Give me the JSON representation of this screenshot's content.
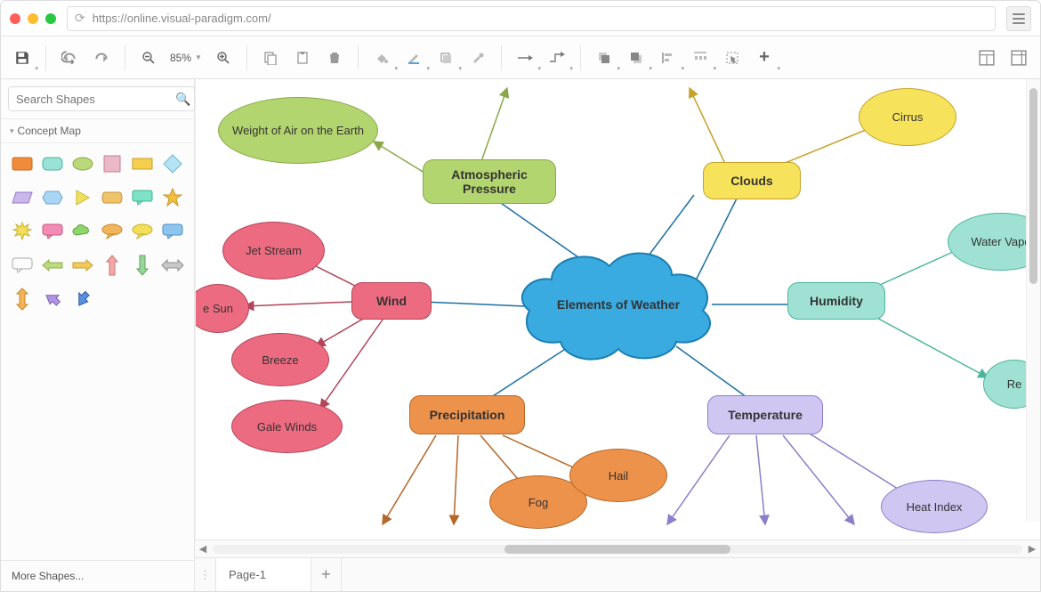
{
  "url": "https://online.visual-paradigm.com/",
  "zoom_level": "85%",
  "search_placeholder": "Search Shapes",
  "section_title": "Concept Map",
  "more_shapes_label": "More Shapes...",
  "page_tab_label": "Page-1",
  "diagram": {
    "center": {
      "label": "Elements of Weather"
    },
    "categories": {
      "atmospheric": {
        "label": "Atmospheric Pressure",
        "children": [
          "Weight of Air on the Earth"
        ]
      },
      "clouds": {
        "label": "Clouds",
        "children": [
          "Cirrus"
        ]
      },
      "wind": {
        "label": "Wind",
        "children": [
          "Jet Stream",
          "e Sun",
          "Breeze",
          "Gale Winds"
        ]
      },
      "humidity": {
        "label": "Humidity",
        "children": [
          "Water Vapo",
          "Re"
        ]
      },
      "precip": {
        "label": "Precipitation",
        "children": [
          "Fog",
          "Hail"
        ]
      },
      "temp": {
        "label": "Temperature",
        "children": [
          "Heat Index"
        ]
      }
    }
  },
  "colors": {
    "center": "#3aabe1",
    "atmos": "#b3d56f",
    "clouds": "#f6e25b",
    "wind": "#ed6b80",
    "humid": "#9fe2d3",
    "precip": "#ed924b",
    "temp": "#cfc6f2"
  }
}
